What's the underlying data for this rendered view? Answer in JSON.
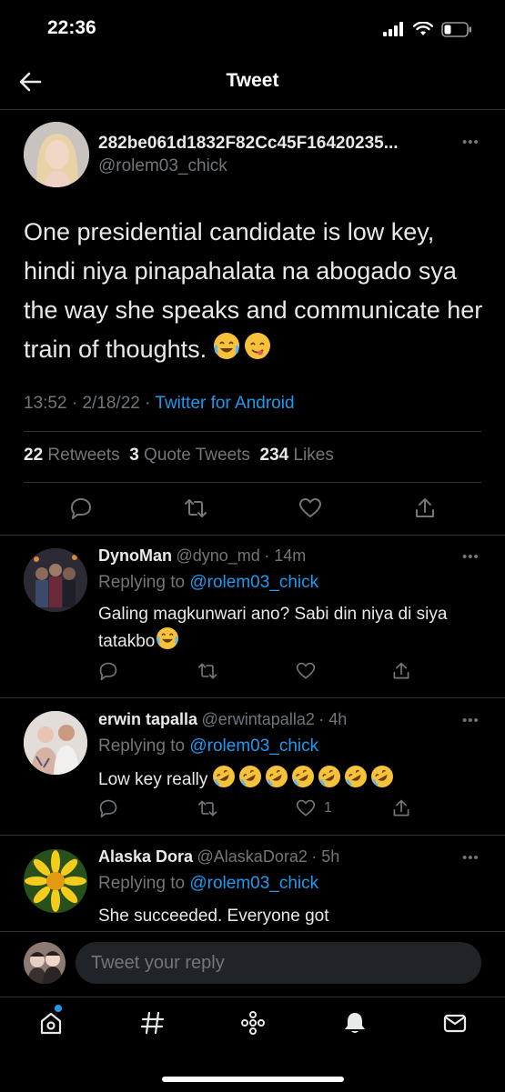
{
  "status_bar": {
    "time": "22:36"
  },
  "header": {
    "title": "Tweet"
  },
  "tweet": {
    "author_name": "282be061d1832F82Cc45F16420235...",
    "handle": "@rolem03_chick",
    "text": "One presidential candidate is low key, hindi niya pinapahalata na abogado sya the way she speaks and communicate her train of thoughts.",
    "text_emojis": [
      "face-with-tears-of-joy",
      "face-savoring-food"
    ],
    "time": "13:52",
    "date": "2/18/22",
    "separator": "·",
    "source": "Twitter for Android",
    "retweets_count": "22",
    "retweets_label": "Retweets",
    "quotes_count": "3",
    "quotes_label": "Quote Tweets",
    "likes_count": "234",
    "likes_label": "Likes"
  },
  "replies": [
    {
      "name": "DynoMan",
      "handle": "@dyno_md",
      "time": "· 14m",
      "replying_prefix": "Replying to",
      "replying_to": "@rolem03_chick",
      "text_line1": "Galing magkunwari ano? Sabi din niya di siya",
      "text_line2": "tatakbo",
      "likes": ""
    },
    {
      "name": "erwin tapalla",
      "handle": "@erwintapalla2",
      "time": "· 4h",
      "replying_prefix": "Replying to",
      "replying_to": "@rolem03_chick",
      "text_line1": "Low key really",
      "text_line2": "",
      "likes": "1"
    },
    {
      "name": "Alaska Dora",
      "handle": "@AlaskaDora2",
      "time": "· 5h",
      "replying_prefix": "Replying to",
      "replying_to": "@rolem03_chick",
      "text_line1": "She succeeded. Everyone got",
      "text_line2": "",
      "likes": ""
    }
  ],
  "compose": {
    "placeholder": "Tweet your reply"
  },
  "bottom_nav": [
    "home-icon",
    "explore-hashtag-icon",
    "spaces-icon",
    "notifications-bell-icon",
    "messages-mail-icon"
  ],
  "colors": {
    "accent": "#1d9bf0",
    "background": "#000000",
    "muted": "#71767b"
  }
}
